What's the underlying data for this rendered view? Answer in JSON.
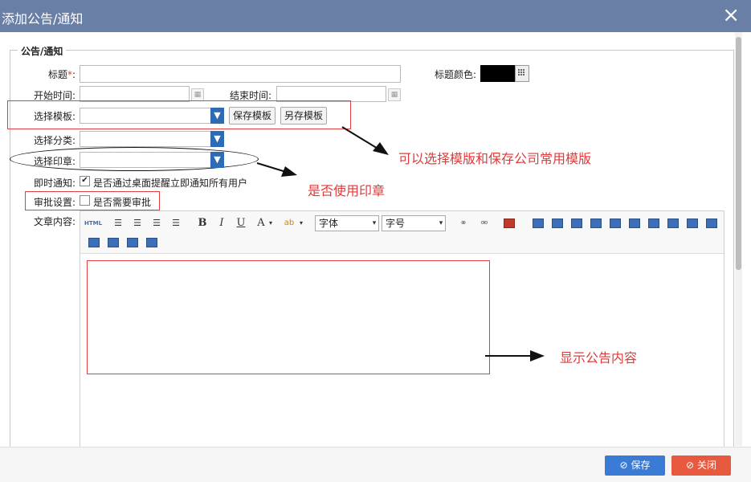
{
  "dialog": {
    "title": "添加公告/通知",
    "close_icon": "×"
  },
  "form": {
    "legend": "公告/通知",
    "title_label": "标题",
    "required_mark": "*",
    "title_colon": ":",
    "title_color_label": "标题颜色:",
    "title_color_value": "#000000",
    "start_label": "开始时间:",
    "end_label": "结束时间:",
    "template_label": "选择模板:",
    "save_template": "保存模板",
    "save_as_template": "另存模板",
    "category_label": "选择分类:",
    "seal_label": "选择印章:",
    "notify_label": "即时通知:",
    "notify_text": "是否通过桌面提醒立即通知所有用户",
    "notify_checked": true,
    "approve_label": "审批设置:",
    "approve_text": "是否需要审批",
    "approve_checked": false,
    "content_label": "文章内容:"
  },
  "editor": {
    "html_btn": "HTML",
    "font_placeholder": "字体",
    "size_placeholder": "字号",
    "bold": "B",
    "italic": "I",
    "underline": "U",
    "font_color": "A"
  },
  "annotations": {
    "template_note": "可以选择模版和保存公司常用模版",
    "seal_note": "是否使用印章",
    "content_note": "显示公告内容"
  },
  "footer": {
    "save": "保存",
    "close": "关闭"
  },
  "colors": {
    "titlebar": "#6a7fa6",
    "primary": "#3a7bd5",
    "danger": "#e85a40",
    "note": "#e03a3a"
  }
}
